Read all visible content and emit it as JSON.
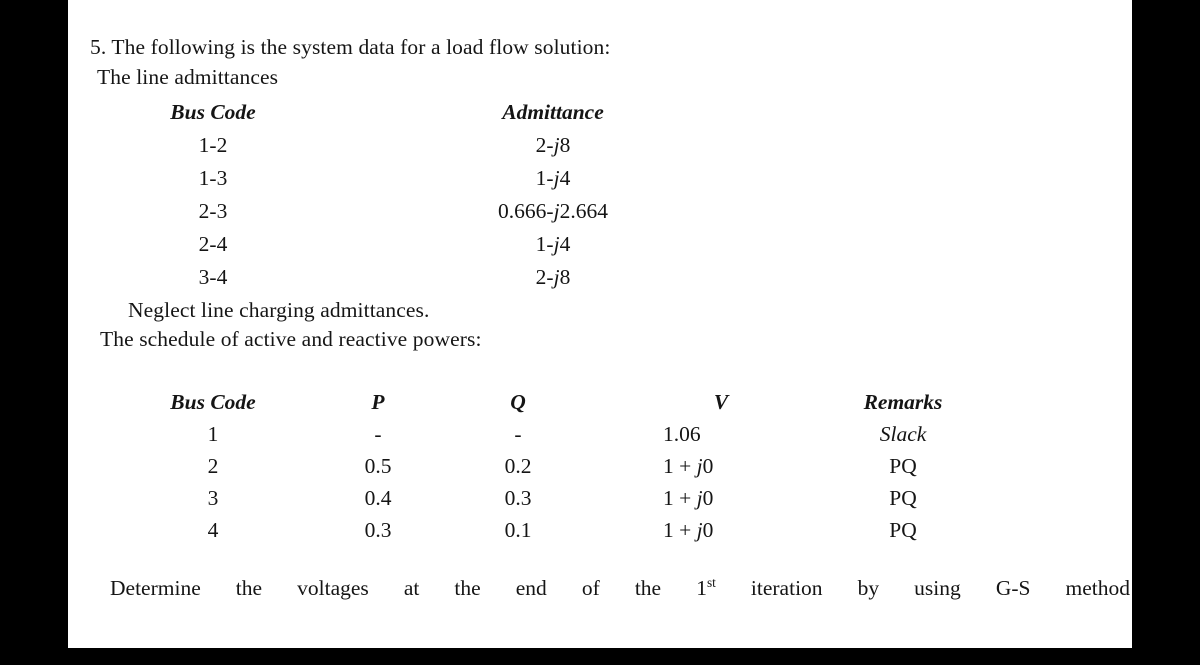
{
  "document": {
    "problem_number": "5.",
    "intro_line_1": "5. The following is the system data for a load flow solution:",
    "intro_line_2": "The line admittances",
    "note_neglect": "Neglect line charging admittances.",
    "note_schedule": "The schedule of active and reactive powers:",
    "page_background": "#ffffff",
    "text_color": "#151515",
    "letterbox_color": "#000000"
  },
  "admittance_table": {
    "headers": {
      "bus_code": "Bus Code",
      "admittance": "Admittance"
    },
    "rows": [
      {
        "bus_code": "1-2",
        "admittance_real": "2",
        "admittance_sign": "-",
        "admittance_j": "j",
        "admittance_imag": "8",
        "admittance": "2-j8"
      },
      {
        "bus_code": "1-3",
        "admittance_real": "1",
        "admittance_sign": "-",
        "admittance_j": "j",
        "admittance_imag": "4",
        "admittance": "1-j4"
      },
      {
        "bus_code": "2-3",
        "admittance_real": "0.666",
        "admittance_sign": "-",
        "admittance_j": "j",
        "admittance_imag": "2.664",
        "admittance": "0.666-j2.664"
      },
      {
        "bus_code": "2-4",
        "admittance_real": "1",
        "admittance_sign": "-",
        "admittance_j": "j",
        "admittance_imag": "4",
        "admittance": "1-j4"
      },
      {
        "bus_code": "3-4",
        "admittance_real": "2",
        "admittance_sign": "-",
        "admittance_j": "j",
        "admittance_imag": "8",
        "admittance": "2-j8"
      }
    ]
  },
  "schedule_table": {
    "headers": {
      "bus_code": "Bus Code",
      "p": "P",
      "q": "Q",
      "v": "V",
      "remarks": "Remarks"
    },
    "rows": [
      {
        "bus_code": "1",
        "p": "-",
        "q": "-",
        "v_real": "1.06",
        "v_op": "",
        "v_j": "",
        "v_imag": "",
        "v": "1.06",
        "remarks": "Slack",
        "remarks_italic": true
      },
      {
        "bus_code": "2",
        "p": "0.5",
        "q": "0.2",
        "v_real": "1",
        "v_op": "+",
        "v_j": "j",
        "v_imag": "0",
        "v": "1 + j0",
        "remarks": "PQ",
        "remarks_italic": false
      },
      {
        "bus_code": "3",
        "p": "0.4",
        "q": "0.3",
        "v_real": "1",
        "v_op": "+",
        "v_j": "j",
        "v_imag": "0",
        "v": "1 + j0",
        "remarks": "PQ",
        "remarks_italic": false
      },
      {
        "bus_code": "4",
        "p": "0.3",
        "q": "0.1",
        "v_real": "1",
        "v_op": "+",
        "v_j": "j",
        "v_imag": "0",
        "v": "1 + j0",
        "remarks": "PQ",
        "remarks_italic": false
      }
    ]
  },
  "closing": {
    "words_before": "Determine the voltages at the end of the",
    "ordinal_number": "1",
    "ordinal_suffix": "st",
    "words_after": "iteration by using G-S method",
    "full_text": "Determine the voltages at the end of the 1st iteration by using G-S method"
  }
}
